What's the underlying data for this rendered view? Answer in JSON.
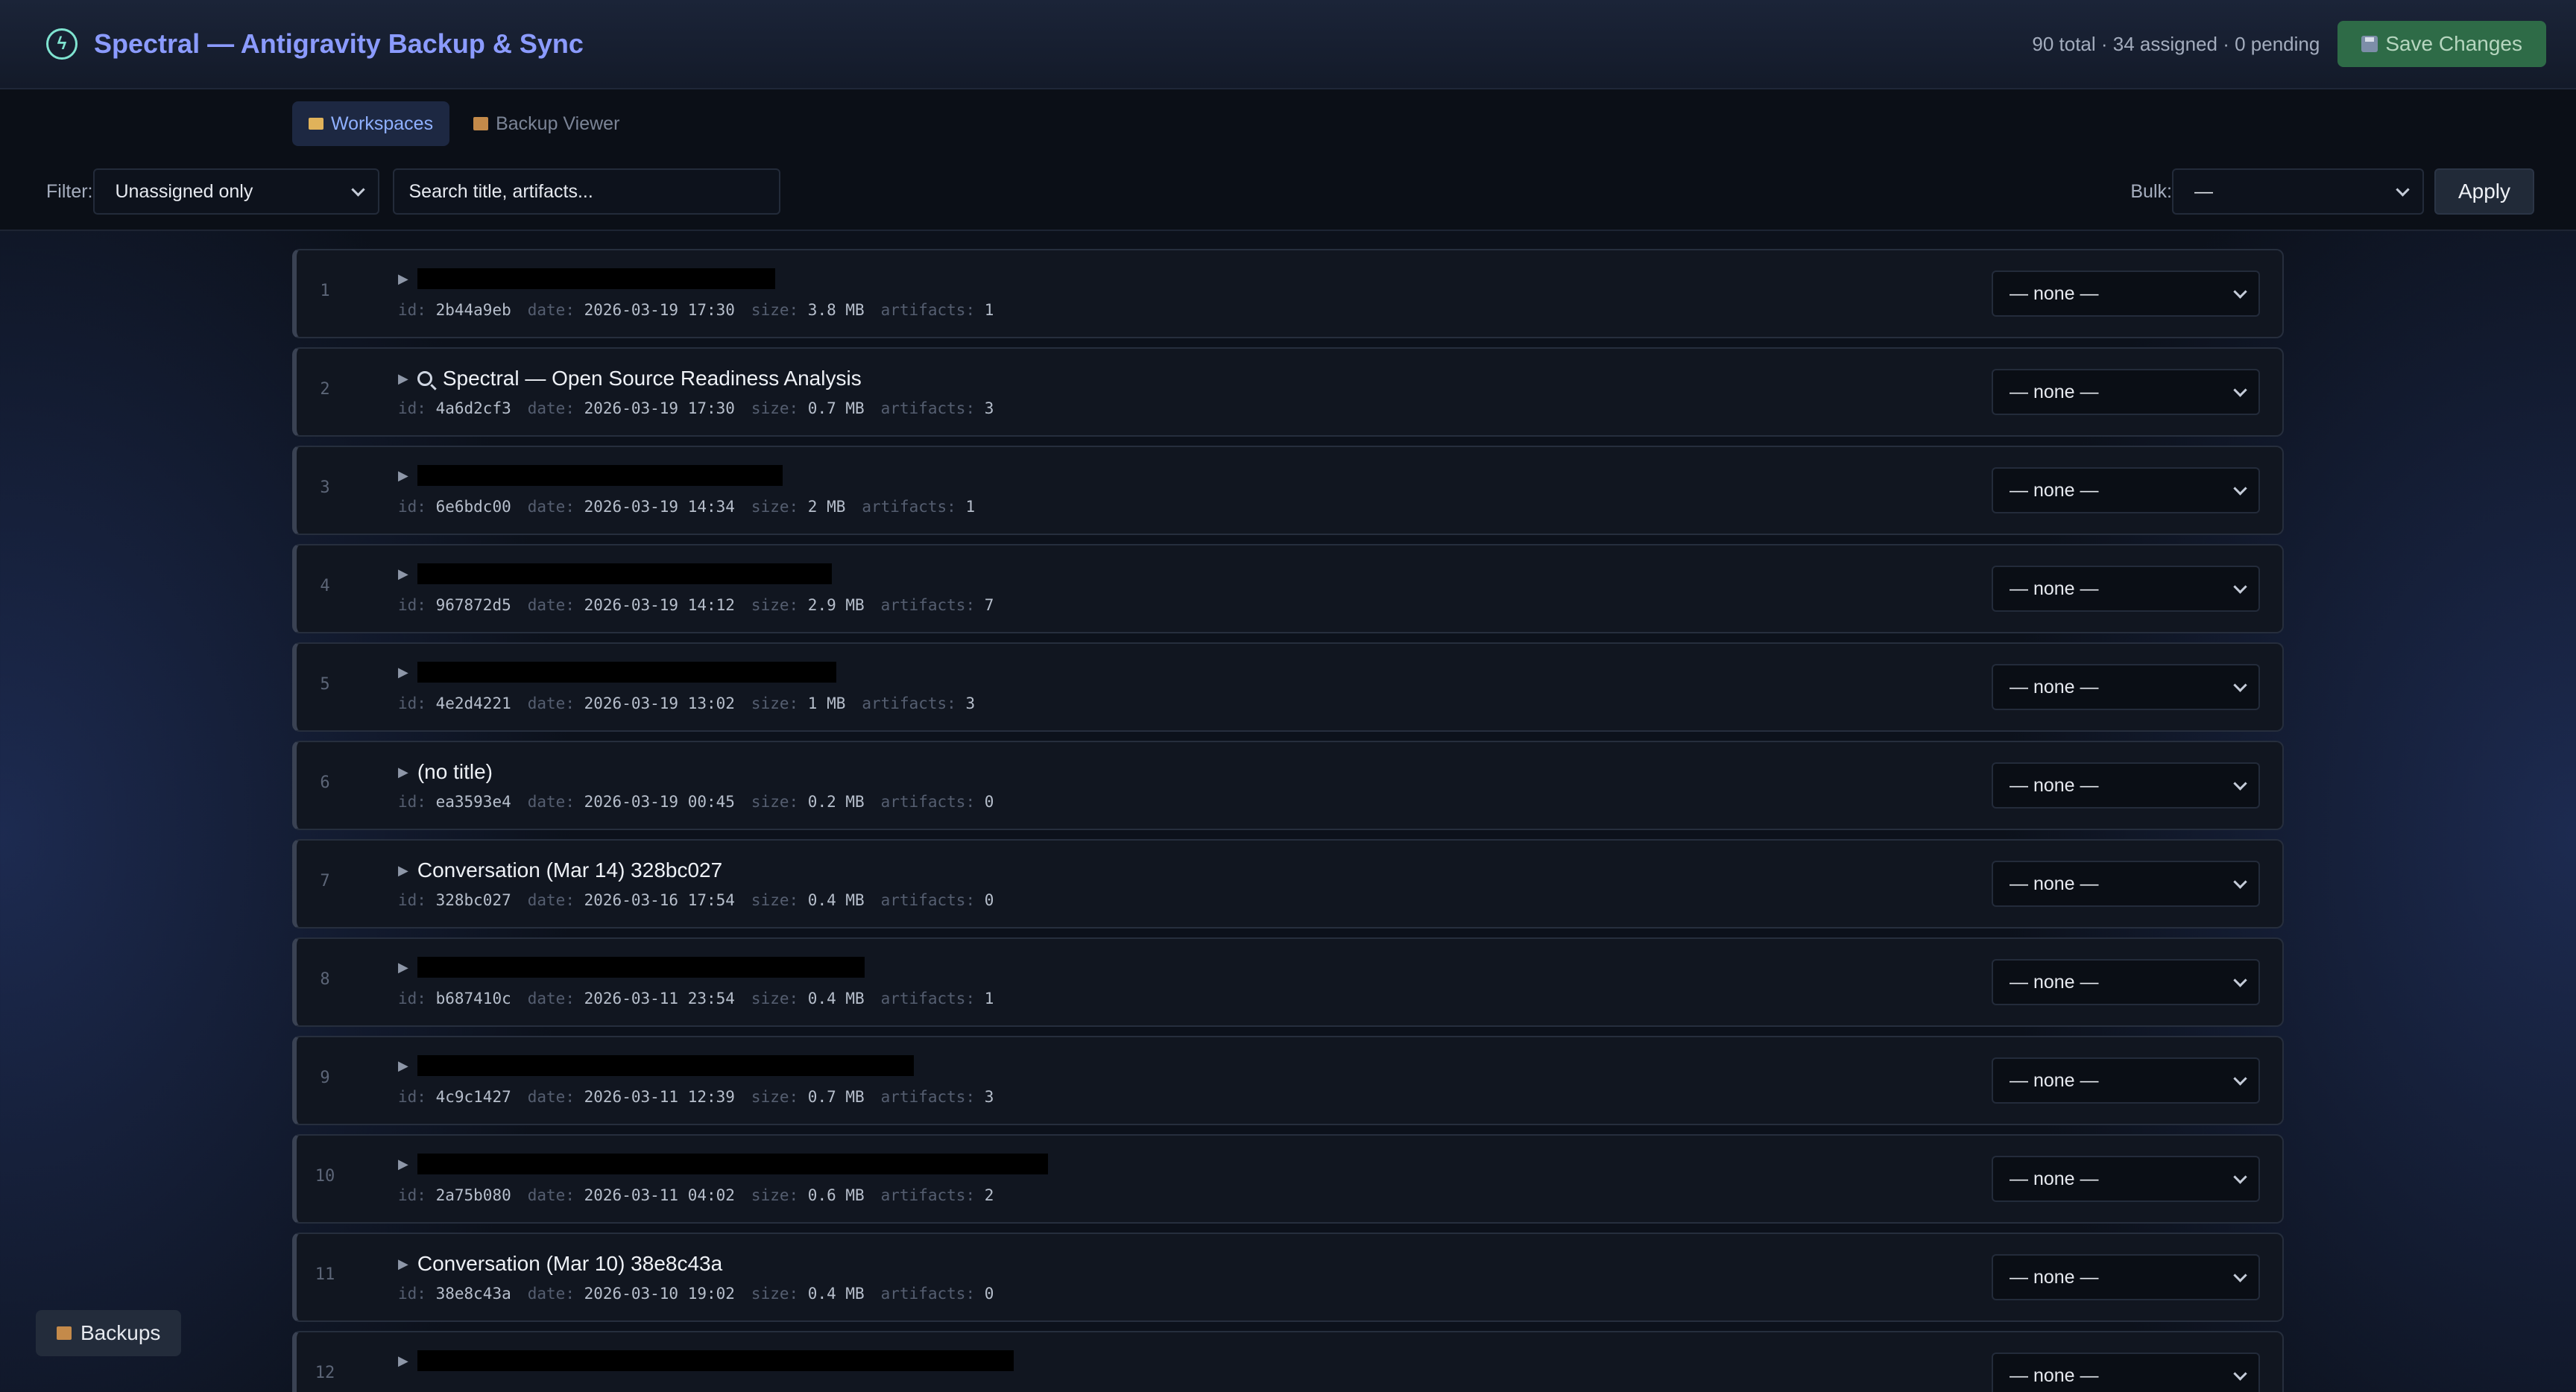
{
  "header": {
    "logo_icon": "bolt-circle-icon",
    "title": "Spectral — Antigravity Backup & Sync",
    "stats": "90 total · 34 assigned · 0 pending",
    "save_label": "Save Changes"
  },
  "tabs": [
    {
      "label": "Workspaces",
      "icon": "folder-icon",
      "active": true
    },
    {
      "label": "Backup Viewer",
      "icon": "package-icon",
      "active": false
    }
  ],
  "filter": {
    "label": "Filter:",
    "value": "Unassigned only",
    "search_placeholder": "Search title, artifacts..."
  },
  "bulk": {
    "label": "Bulk:",
    "value": "—",
    "apply_label": "Apply"
  },
  "meta_labels": {
    "id": "id:",
    "date": "date:",
    "size": "size:",
    "artifacts": "artifacts:"
  },
  "assign_default": "— none —",
  "rows": [
    {
      "index": "1",
      "title": "",
      "id": "2b44a9eb",
      "date": "2026-03-19 17:30",
      "size": "3.8 MB",
      "artifacts": "1"
    },
    {
      "index": "2",
      "title": "Spectral — Open Source Readiness Analysis",
      "id": "4a6d2cf3",
      "date": "2026-03-19 17:30",
      "size": "0.7 MB",
      "artifacts": "3"
    },
    {
      "index": "3",
      "title": "",
      "id": "6e6bdc00",
      "date": "2026-03-19 14:34",
      "size": "2 MB",
      "artifacts": "1"
    },
    {
      "index": "4",
      "title": "",
      "id": "967872d5",
      "date": "2026-03-19 14:12",
      "size": "2.9 MB",
      "artifacts": "7"
    },
    {
      "index": "5",
      "title": "",
      "id": "4e2d4221",
      "date": "2026-03-19 13:02",
      "size": "1 MB",
      "artifacts": "3"
    },
    {
      "index": "6",
      "title": "(no title)",
      "id": "ea3593e4",
      "date": "2026-03-19 00:45",
      "size": "0.2 MB",
      "artifacts": "0"
    },
    {
      "index": "7",
      "title": "Conversation (Mar 14) 328bc027",
      "id": "328bc027",
      "date": "2026-03-16 17:54",
      "size": "0.4 MB",
      "artifacts": "0"
    },
    {
      "index": "8",
      "title": "",
      "id": "b687410c",
      "date": "2026-03-11 23:54",
      "size": "0.4 MB",
      "artifacts": "1"
    },
    {
      "index": "9",
      "title": "",
      "id": "4c9c1427",
      "date": "2026-03-11 12:39",
      "size": "0.7 MB",
      "artifacts": "3"
    },
    {
      "index": "10",
      "title": "",
      "id": "2a75b080",
      "date": "2026-03-11 04:02",
      "size": "0.6 MB",
      "artifacts": "2"
    },
    {
      "index": "11",
      "title": "Conversation (Mar 10) 38e8c43a",
      "id": "38e8c43a",
      "date": "2026-03-10 19:02",
      "size": "0.4 MB",
      "artifacts": "0"
    },
    {
      "index": "12",
      "title": "",
      "id": "",
      "date": "",
      "size": "",
      "artifacts": ""
    }
  ],
  "backups_button": "Backups"
}
